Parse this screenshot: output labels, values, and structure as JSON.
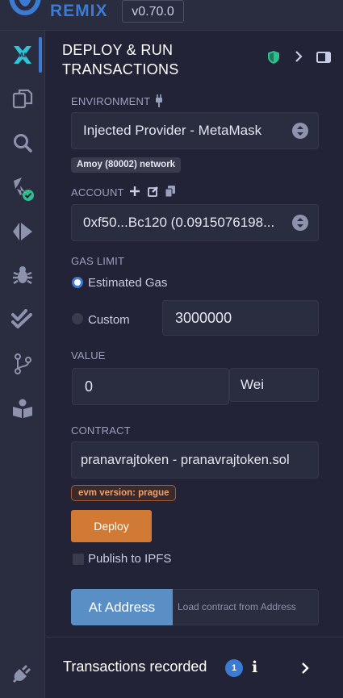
{
  "app": {
    "brand": "REMIX",
    "version": "v0.70.0"
  },
  "rail": {
    "items": [
      {
        "name": "ai-icon"
      },
      {
        "name": "file-explorer-icon"
      },
      {
        "name": "search-icon"
      },
      {
        "name": "solidity-compiler-icon"
      },
      {
        "name": "deploy-run-icon"
      },
      {
        "name": "debugger-icon"
      },
      {
        "name": "testing-icon"
      },
      {
        "name": "git-icon"
      },
      {
        "name": "learn-icon"
      },
      {
        "name": "plugin-manager-icon"
      }
    ]
  },
  "header": {
    "title": "DEPLOY & RUN TRANSACTIONS"
  },
  "environment": {
    "label": "ENVIRONMENT",
    "value": "Injected Provider - MetaMask",
    "network_badge": "Amoy (80002) network"
  },
  "account": {
    "label": "ACCOUNT",
    "value": "0xf50...Bc120 (0.0915076198..."
  },
  "gas": {
    "label": "GAS LIMIT",
    "estimated_label": "Estimated Gas",
    "custom_label": "Custom",
    "custom_value": "3000000",
    "selected": "estimated"
  },
  "value": {
    "label": "VALUE",
    "amount": "0",
    "unit": "Wei"
  },
  "contract": {
    "label": "CONTRACT",
    "value": "pranavrajtoken - pranavrajtoken.sol",
    "evm_badge": "evm version: prague"
  },
  "deploy": {
    "button_label": "Deploy",
    "publish_label": "Publish to IPFS"
  },
  "at_address": {
    "button_label": "At Address",
    "placeholder": "Load contract from Address"
  },
  "transactions": {
    "title": "Transactions recorded",
    "count": "1",
    "info": "i"
  },
  "colors": {
    "accent": "#3b7bd4",
    "deploy": "#d07a36",
    "success": "#2fbf8f",
    "background": "#222336",
    "surface": "#2a2c3f"
  }
}
